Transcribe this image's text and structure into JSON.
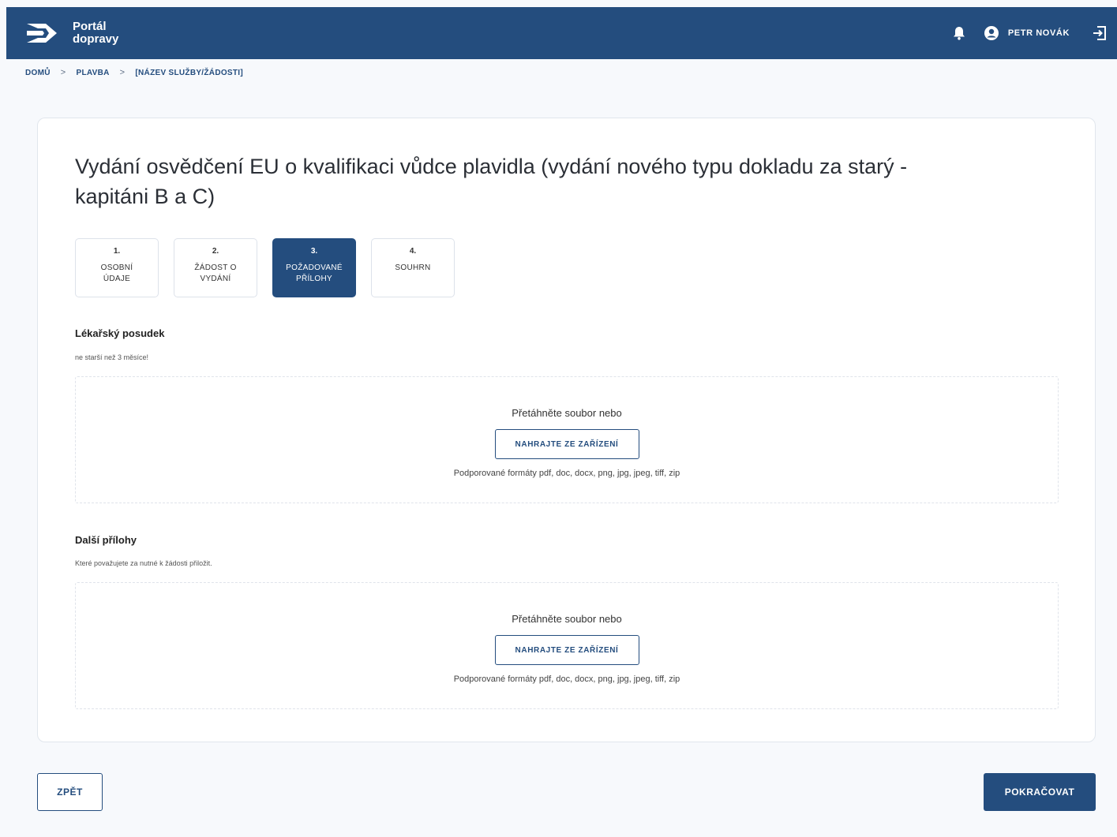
{
  "header": {
    "brand_line1": "Portál",
    "brand_line2": "dopravy",
    "bg_color": "#244d7e",
    "logo_icon": "portal-logo-icon",
    "bell_icon": "bell-icon",
    "user_icon": "user-avatar-icon",
    "user_name": "PETR NOVÁK",
    "logout_icon": "logout-icon"
  },
  "breadcrumb": {
    "items": [
      "DOMŮ",
      "PLAVBA",
      "[NÁZEV SLUŽBY/ŽÁDOSTI]"
    ],
    "separator": ">"
  },
  "page": {
    "title": "Vydání osvědčení EU o kvalifikaci vůdce plavidla (vydání nového typu dokladu za starý - kapitáni B a C)"
  },
  "steps": [
    {
      "number": "1.",
      "label_line1": "OSOBNÍ",
      "label_line2": "ÚDAJE",
      "active": false
    },
    {
      "number": "2.",
      "label_line1": "ŽÁDOST O",
      "label_line2": "VYDÁNÍ",
      "active": false
    },
    {
      "number": "3.",
      "label_line1": "POŽADOVANÉ",
      "label_line2": "PŘÍLOHY",
      "active": true
    },
    {
      "number": "4.",
      "label_line1": "SOUHRN",
      "label_line2": "",
      "active": false
    }
  ],
  "sections": [
    {
      "title": "Lékařský posudek",
      "description": "ne starší než 3 měsíce!",
      "drop_text": "Přetáhněte soubor nebo",
      "upload_label": "NAHRAJTE ZE ZAŘÍZENÍ",
      "formats": "Podporované formáty pdf, doc, docx, png, jpg, jpeg, tiff, zip"
    },
    {
      "title": "Další přílohy",
      "description": "Které považujete za nutné k žádosti přiložit.",
      "drop_text": "Přetáhněte soubor nebo",
      "upload_label": "NAHRAJTE ZE ZAŘÍZENÍ",
      "formats": "Podporované formáty pdf, doc, docx, png, jpg, jpeg, tiff, zip"
    }
  ],
  "footer": {
    "back_label": "ZPĚT",
    "next_label": "POKRAČOVAT"
  }
}
